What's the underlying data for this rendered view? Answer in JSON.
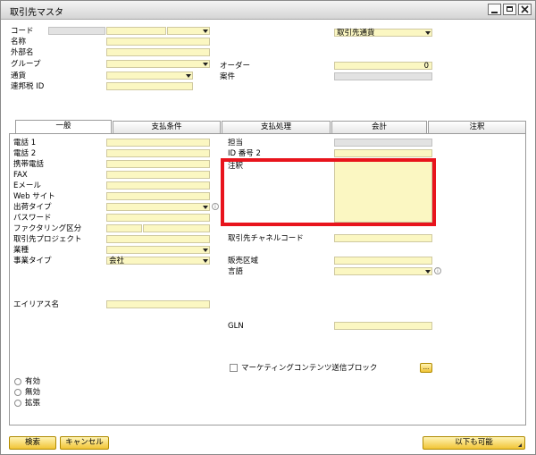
{
  "window": {
    "title": "取引先マスタ"
  },
  "header_left": {
    "code_label": "コード",
    "name_label": "名称",
    "foreign_name_label": "外部名",
    "group_label": "グループ",
    "currency_label": "通貨",
    "federal_tax_label": "連邦税 ID"
  },
  "header_right": {
    "currency_select": "取引先通貨",
    "orders_label": "オーダー",
    "orders_value": "0",
    "opportunities_label": "案件"
  },
  "tabs": [
    {
      "label": "一般"
    },
    {
      "label": "支払条件"
    },
    {
      "label": "支払処理"
    },
    {
      "label": "会計"
    },
    {
      "label": "注釈"
    }
  ],
  "general_left": {
    "tel1": "電話 1",
    "tel2": "電話 2",
    "mobile": "携帯電話",
    "fax": "FAX",
    "email": "Eメール",
    "website": "Web サイト",
    "shipping_type": "出荷タイプ",
    "password": "パスワード",
    "factoring": "ファクタリング区分",
    "bp_project": "取引先プロジェクト",
    "industry": "業種",
    "business_type": "事業タイプ",
    "business_type_value": "会社",
    "alias": "エイリアス名"
  },
  "general_right": {
    "contact_person": "担当",
    "id_no2": "ID 番号 2",
    "remarks": "注釈",
    "bp_channel_code": "取引先チャネルコード",
    "territory": "販売区域",
    "language": "言語",
    "gln": "GLN",
    "block_marketing": "マーケティングコンテンツ送信ブロック",
    "ellipsis": "..."
  },
  "status": {
    "active": "有効",
    "inactive": "無効",
    "advanced": "拡張"
  },
  "footer": {
    "find": "検索",
    "cancel": "キャンセル",
    "also_possible": "以下も可能"
  },
  "colors": {
    "field_bg": "#fbf7c2",
    "highlight_box": "#e8141c",
    "button_gold": "#f1c435"
  }
}
